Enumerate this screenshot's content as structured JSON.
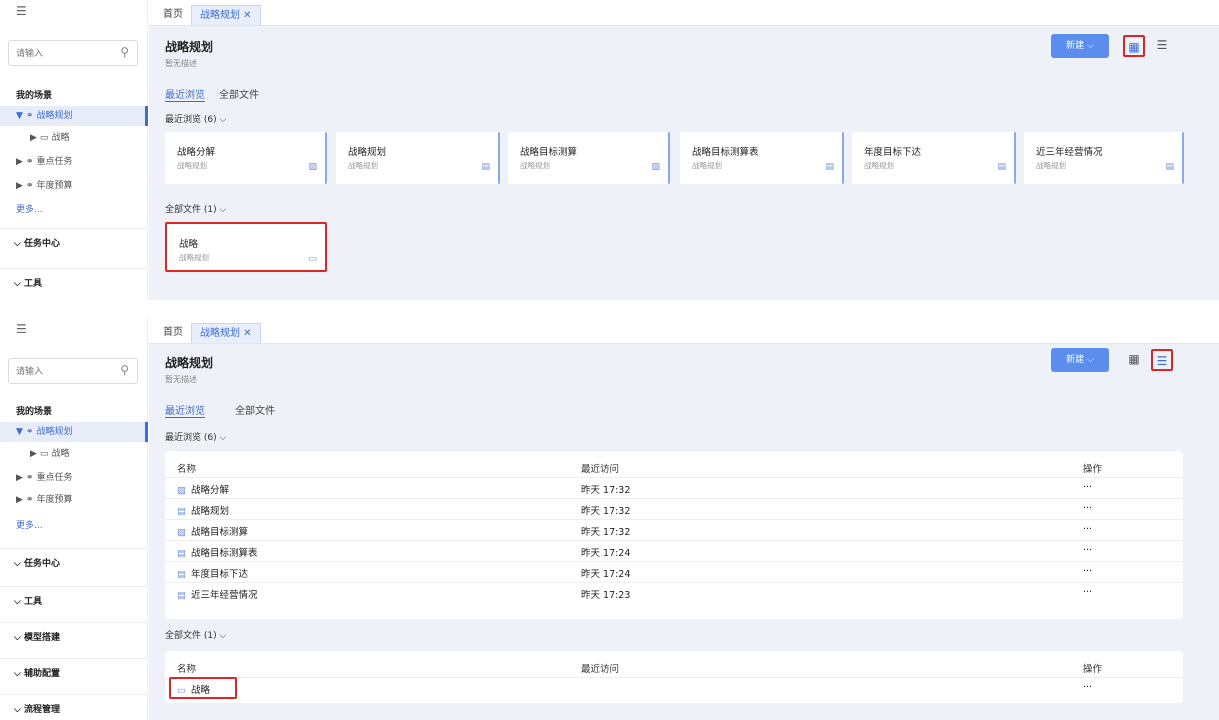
{
  "sidebar": {
    "menu_icon": "☰",
    "search_placeholder": "请输入",
    "section_title": "我的场景",
    "items": [
      {
        "label": "战略规划",
        "icon": "⚭",
        "arrow": "▼"
      },
      {
        "label": "战略",
        "icon": "▭",
        "arrow": "▶"
      },
      {
        "label": "重点任务",
        "icon": "⚭",
        "arrow": "▶"
      },
      {
        "label": "年度预算",
        "icon": "⚭",
        "arrow": "▶"
      }
    ],
    "more": "更多...",
    "groups": [
      "任务中心",
      "工具",
      "模型搭建",
      "辅助配置",
      "流程管理"
    ]
  },
  "tabs": {
    "home": "首页",
    "current": "战略规划 ✕"
  },
  "header": {
    "title": "战略规划",
    "desc": "暂无描述",
    "new_button": "新建 ⌵",
    "grid_icon": "▦",
    "list_icon": "☰"
  },
  "subtabs": {
    "recent": "最近浏览",
    "all": "全部文件"
  },
  "recent_label": "最近浏览 (6) ⌵",
  "all_label": "全部文件 (1) ⌵",
  "recent_cards": [
    {
      "title": "战略分解",
      "sub": "战略规划",
      "icon": "▨"
    },
    {
      "title": "战略规划",
      "sub": "战略规划",
      "icon": "▤"
    },
    {
      "title": "战略目标测算",
      "sub": "战略规划",
      "icon": "▨"
    },
    {
      "title": "战略目标测算表",
      "sub": "战略规划",
      "icon": "▤"
    },
    {
      "title": "年度目标下达",
      "sub": "战略规划",
      "icon": "▤"
    },
    {
      "title": "近三年经营情况",
      "sub": "战略规划",
      "icon": "▤"
    }
  ],
  "all_cards": [
    {
      "title": "战略",
      "sub": "战略规划",
      "icon": "▭"
    }
  ],
  "table": {
    "headers": {
      "name": "名称",
      "visit": "最近访问",
      "op": "操作"
    },
    "recent_rows": [
      {
        "name": "战略分解",
        "icon": "▨",
        "time": "昨天 17:32",
        "op": "···"
      },
      {
        "name": "战略规划",
        "icon": "▤",
        "time": "昨天 17:32",
        "op": "···"
      },
      {
        "name": "战略目标测算",
        "icon": "▨",
        "time": "昨天 17:32",
        "op": "···"
      },
      {
        "name": "战略目标测算表",
        "icon": "▤",
        "time": "昨天 17:24",
        "op": "···"
      },
      {
        "name": "年度目标下达",
        "icon": "▤",
        "time": "昨天 17:24",
        "op": "···"
      },
      {
        "name": "近三年经营情况",
        "icon": "▤",
        "time": "昨天 17:23",
        "op": "···"
      }
    ],
    "all_rows": [
      {
        "name": "战略",
        "icon": "▭",
        "time": "",
        "op": "···"
      }
    ]
  }
}
